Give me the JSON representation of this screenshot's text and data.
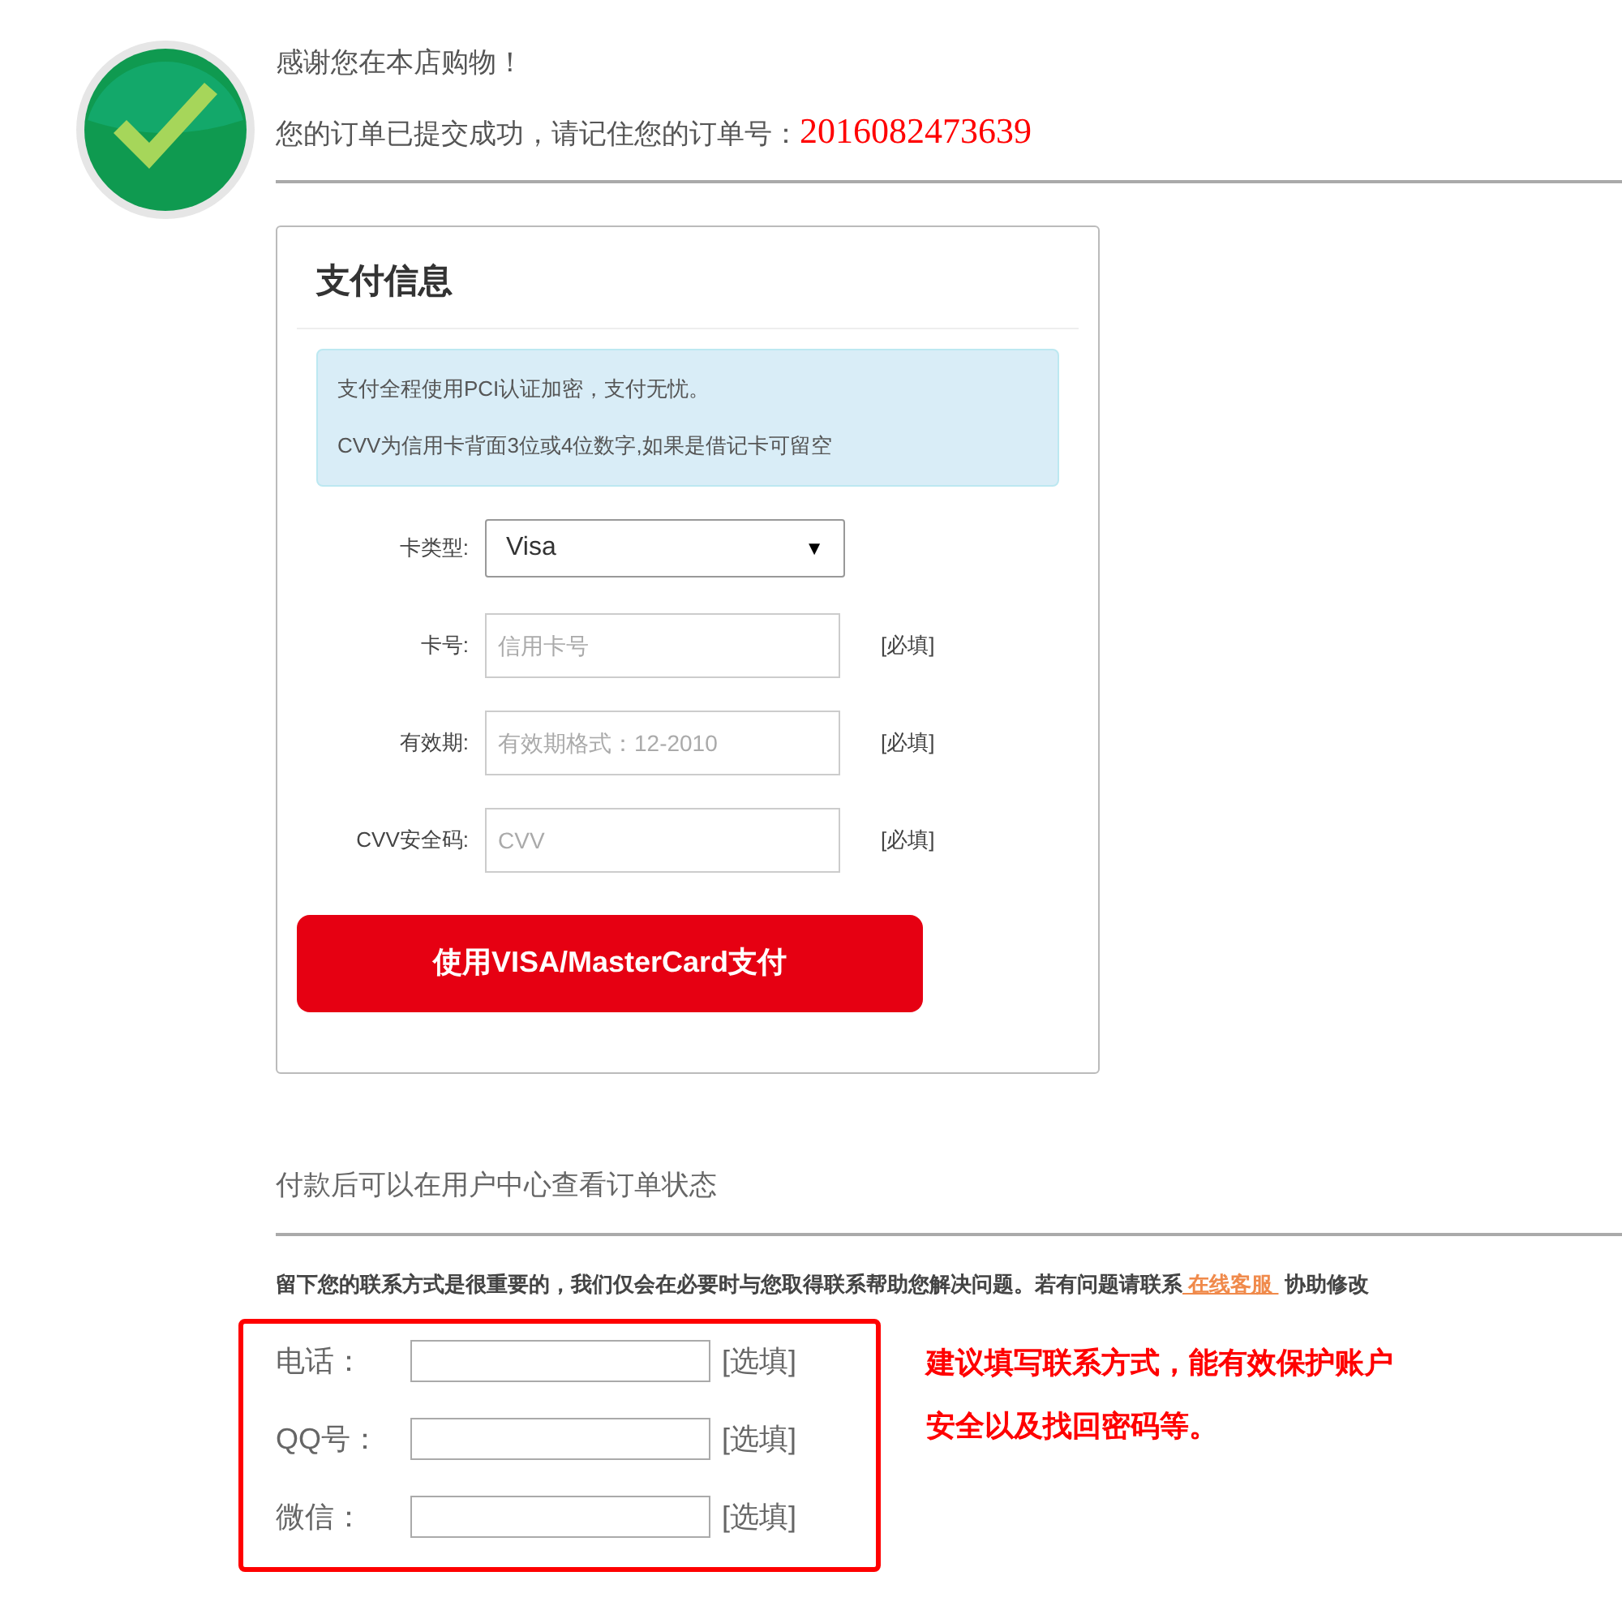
{
  "header": {
    "thanks": "感谢您在本店购物！",
    "order_label": "您的订单已提交成功，请记住您的订单号：",
    "order_number": "2016082473639"
  },
  "payment_card": {
    "title": "支付信息",
    "notices": [
      "支付全程使用PCI认证加密，支付无忧。",
      "CVV为信用卡背面3位或4位数字,如果是借记卡可留空"
    ],
    "fields": [
      {
        "kind": "select",
        "label": "卡类型:",
        "value": "Visa",
        "caret": "▼"
      },
      {
        "kind": "input",
        "label": "卡号:",
        "placeholder": "信用卡号",
        "tag": "[必填]"
      },
      {
        "kind": "input",
        "label": "有效期:",
        "placeholder": "有效期格式：12-2010",
        "tag": "[必填]"
      },
      {
        "kind": "input",
        "label": "CVV安全码:",
        "placeholder": "CVV",
        "tag": "[必填]"
      }
    ],
    "pay_button": "使用VISA/MasterCard支付"
  },
  "status_hint": "付款后可以在用户中心查看订单状态",
  "contact_note": {
    "before": "留下您的联系方式是很重要的，我们仅会在必要时与您取得联系帮助您解决问题。若有问题请联系",
    "link": " 在线客服 ",
    "after": "协助修改"
  },
  "contact_fields": [
    {
      "label": "电话：",
      "tag": "[选填]"
    },
    {
      "label": "QQ号：",
      "tag": "[选填]"
    },
    {
      "label": "微信：",
      "tag": "[选填]"
    }
  ],
  "contact_tip": [
    "建议填写联系方式，能有效保护账户",
    "安全以及找回密码等。"
  ]
}
